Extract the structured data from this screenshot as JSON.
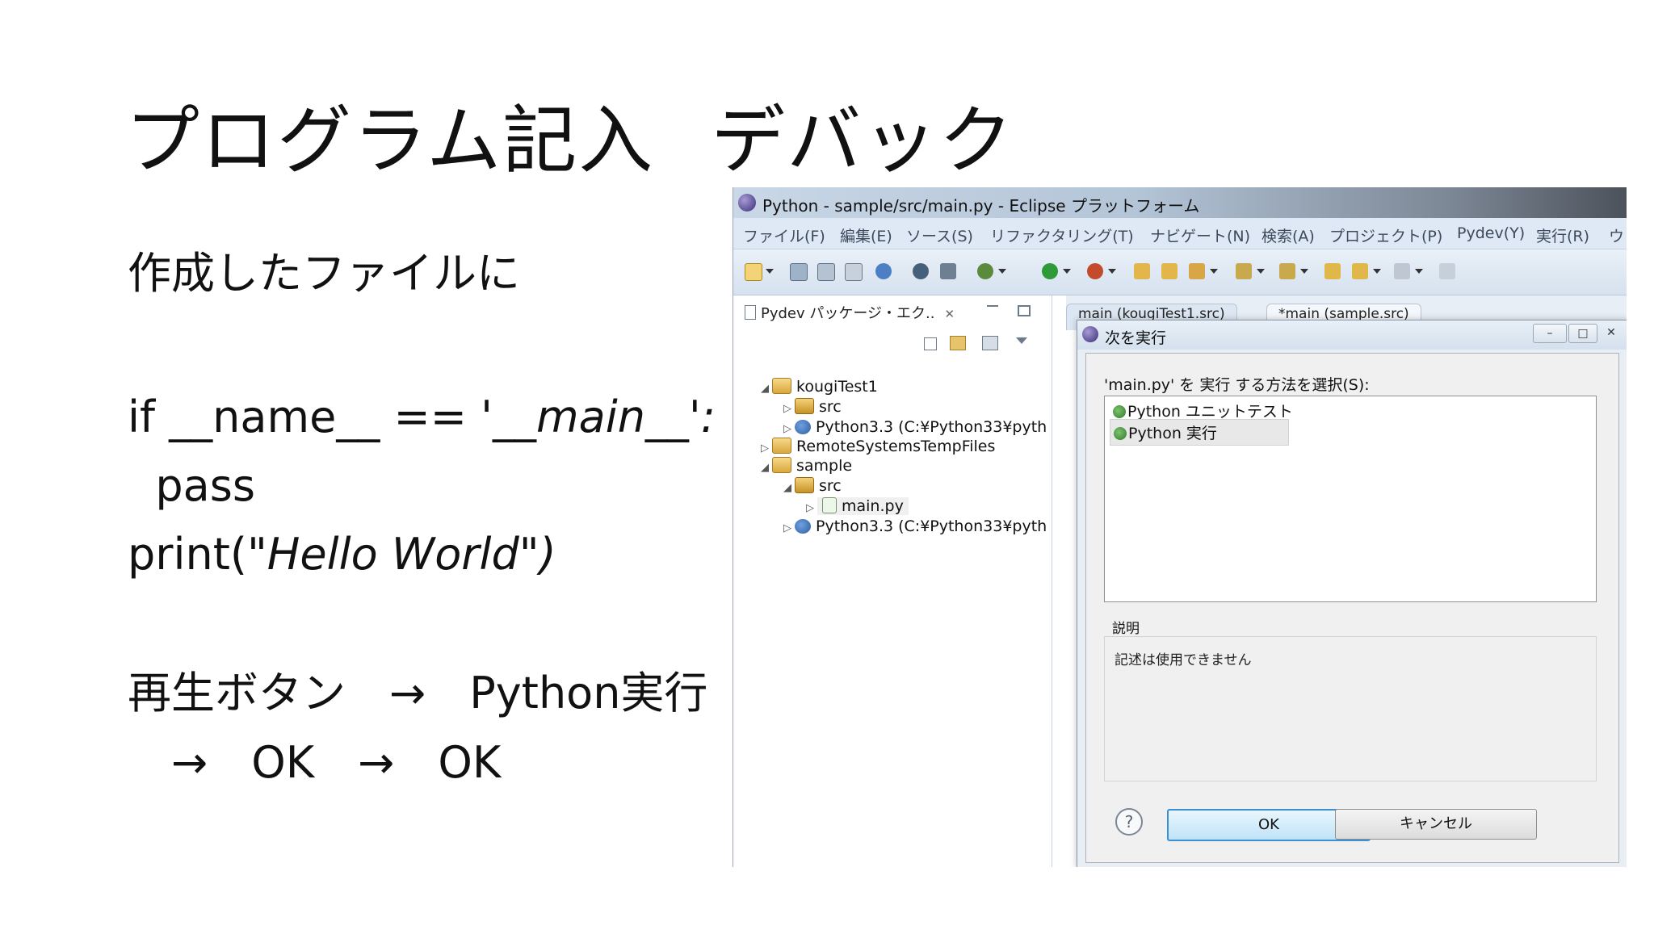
{
  "slide": {
    "title": "プログラム記入",
    "title_suffix": "デバック",
    "intro": "作成したファイルに",
    "code_line1_plain": "if __name__ == '",
    "code_line1_italic": "__main__':",
    "code_line2": "  pass",
    "code_line3_plain": "print(",
    "code_line3_italic": "\"Hello World\")",
    "step_line1": "再生ボタン　→　Python実行",
    "step_line2": "　→　OK　→　OK"
  },
  "window": {
    "title": "Python - sample/src/main.py - Eclipse プラットフォーム",
    "menu": [
      "ファイル(F)",
      "編集(E)",
      "ソース(S)",
      "リファクタリング(T)",
      "ナビゲート(N)",
      "検索(A)",
      "プロジェクト(P)",
      "Pydev(Y)",
      "実行(R)",
      "ウ"
    ]
  },
  "explorer": {
    "tab_label": "Pydev パッケージ・エク..",
    "close_glyph": "✕",
    "tree": {
      "kougi": "kougiTest1",
      "kougi_src": "src",
      "kougi_py": "Python3.3  (C:¥Python33¥pyth",
      "remote": "RemoteSystemsTempFiles",
      "sample": "sample",
      "sample_src": "src",
      "main_py": "main.py",
      "sample_py": "Python3.3  (C:¥Python33¥pyth"
    }
  },
  "editor": {
    "tab1": "main (kougiTest1.src)",
    "tab2": "*main (sample.src)"
  },
  "dialog": {
    "title": "次を実行",
    "prompt": "'main.py' を 実行 する方法を選択(S):",
    "options": [
      "Python ユニットテスト",
      "Python 実行"
    ],
    "desc_label": "説明",
    "desc_text": "記述は使用できません",
    "ok_label": "OK",
    "cancel_label": "キャンセル",
    "help_glyph": "?"
  }
}
